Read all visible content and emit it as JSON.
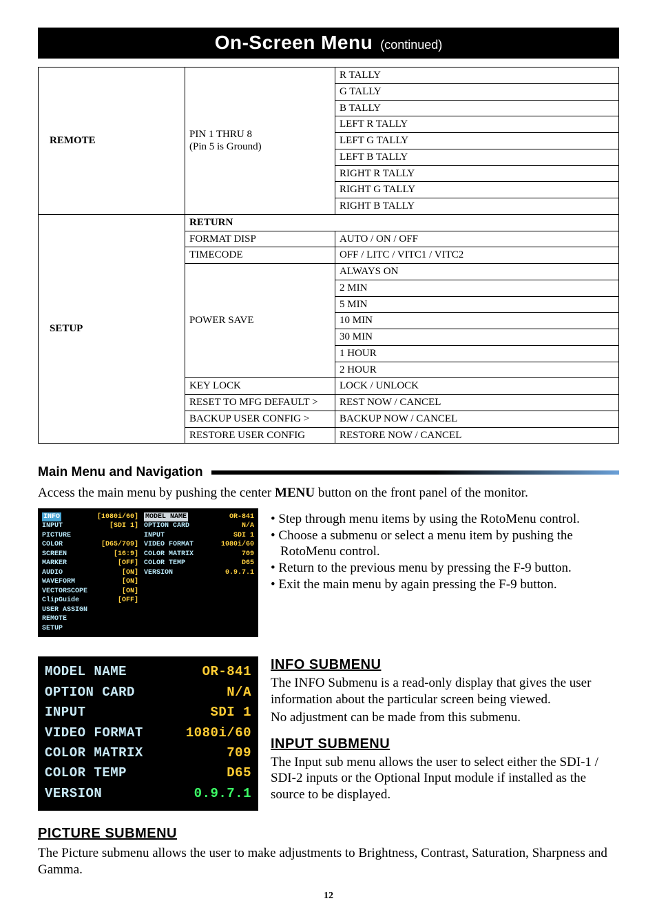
{
  "banner": {
    "title": "On-Screen Menu",
    "sub": "(continued)"
  },
  "table": {
    "remote": {
      "label": "REMOTE",
      "setting": {
        "l1": "PIN 1 THRU 8",
        "l2": "(Pin 5 is Ground)"
      },
      "values": [
        "R TALLY",
        "G TALLY",
        "B TALLY",
        "LEFT R TALLY",
        "LEFT G TALLY",
        "LEFT B TALLY",
        "RIGHT R TALLY",
        "RIGHT G TALLY",
        "RIGHT B TALLY"
      ]
    },
    "setup": {
      "label": "SETUP",
      "return": "RETURN",
      "rows": [
        {
          "k": "FORMAT DISP",
          "v": "AUTO / ON / OFF"
        },
        {
          "k": "TIMECODE",
          "v": "OFF / LITC / VITC1 / VITC2"
        }
      ],
      "powersave": {
        "label": "POWER SAVE",
        "values": [
          "ALWAYS ON",
          "2 MIN",
          "5 MIN",
          "10 MIN",
          "30 MIN",
          "1 HOUR",
          "2 HOUR"
        ]
      },
      "rows2": [
        {
          "k": "KEY LOCK",
          "v": "LOCK / UNLOCK"
        },
        {
          "k": "RESET TO MFG DEFAULT >",
          "v": "REST NOW / CANCEL"
        },
        {
          "k": "BACKUP USER CONFIG >",
          "v": "BACKUP NOW / CANCEL"
        },
        {
          "k": "RESTORE USER CONFIG",
          "v": "RESTORE NOW / CANCEL"
        }
      ]
    }
  },
  "main": {
    "heading": "Main Menu and Navigation",
    "intro_a": "Access the main menu by pushing the center ",
    "intro_b": "MENU",
    "intro_c": " button on the front panel of the monitor.",
    "bullets": [
      "Step through menu items by using the RotoMenu control.",
      "Choose a submenu or select a menu item by pushing the",
      "RotoMenu control.",
      "Return to the previous menu by pressing the F-9 button.",
      "Exit the main menu by again pressing the F-9 button."
    ]
  },
  "osd_left": [
    {
      "k": "INFO",
      "v": "[1080i/60]"
    },
    {
      "k": "INPUT",
      "v": "[SDI 1]"
    },
    {
      "k": "PICTURE",
      "v": ""
    },
    {
      "k": "COLOR",
      "v": "[D65/709]"
    },
    {
      "k": "SCREEN",
      "v": "[16:9]"
    },
    {
      "k": "MARKER",
      "v": "[OFF]"
    },
    {
      "k": "AUDIO",
      "v": "[ON]"
    },
    {
      "k": "WAVEFORM",
      "v": "[ON]"
    },
    {
      "k": "VECTORSCOPE",
      "v": "[ON]"
    },
    {
      "k": "ClipGuide",
      "v": "[OFF]"
    },
    {
      "k": "USER ASSIGN",
      "v": ""
    },
    {
      "k": "REMOTE",
      "v": ""
    },
    {
      "k": "SETUP",
      "v": ""
    }
  ],
  "osd_right": [
    {
      "k": "MODEL NAME",
      "v": "OR-841"
    },
    {
      "k": "OPTION CARD",
      "v": "N/A"
    },
    {
      "k": "INPUT",
      "v": "SDI 1"
    },
    {
      "k": "VIDEO FORMAT",
      "v": "1080i/60"
    },
    {
      "k": "COLOR MATRIX",
      "v": "709"
    },
    {
      "k": "COLOR TEMP",
      "v": "D65"
    },
    {
      "k": "VERSION",
      "v": "0.9.7.1"
    }
  ],
  "osd_large": [
    {
      "k": "MODEL NAME",
      "v": "OR-841",
      "cls": ""
    },
    {
      "k": "OPTION CARD",
      "v": "N/A",
      "cls": ""
    },
    {
      "k": "INPUT",
      "v": "SDI 1",
      "cls": ""
    },
    {
      "k": "VIDEO FORMAT",
      "v": "1080i/60",
      "cls": ""
    },
    {
      "k": "COLOR MATRIX",
      "v": "709",
      "cls": ""
    },
    {
      "k": "COLOR TEMP",
      "v": "D65",
      "cls": ""
    },
    {
      "k": "VERSION",
      "v": "0.9.7.1",
      "cls": "ver"
    }
  ],
  "info": {
    "heading": "INFO SUBMENU",
    "p1": "The INFO Submenu is a read-only display that gives the user information about the particular screen being viewed.",
    "p2": "No adjustment can be made from this submenu."
  },
  "input": {
    "heading": "INPUT SUBMENU",
    "p": "The Input sub menu allows the user to select either the SDI-1 / SDI-2 inputs or the Optional Input module if installed as the source to be displayed."
  },
  "picture": {
    "heading": "PICTURE SUBMENU",
    "p": "The Picture submenu allows the user to make adjustments to Brightness, Contrast, Saturation, Sharpness and Gamma."
  },
  "pagenum": "12"
}
